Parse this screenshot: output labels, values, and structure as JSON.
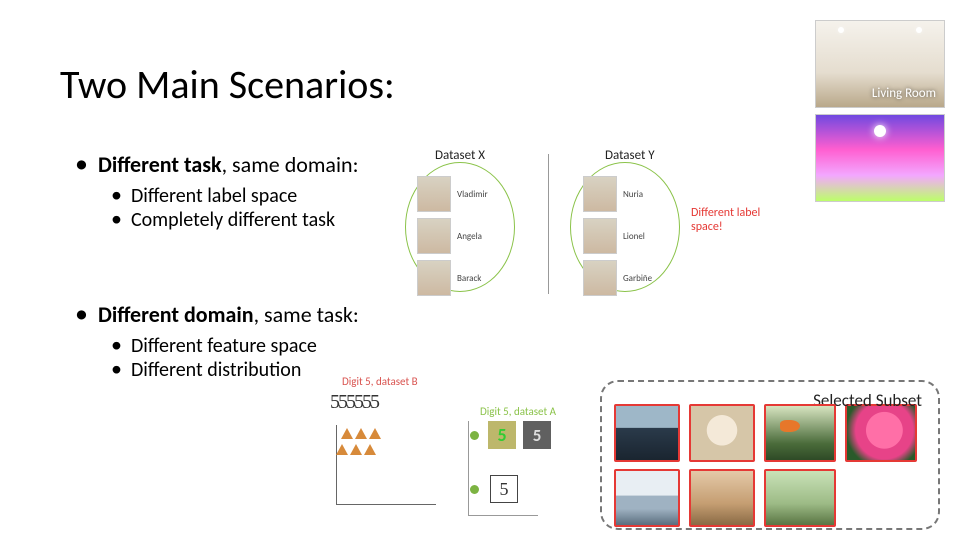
{
  "title": "Two Main Scenarios:",
  "scenario1": {
    "strong": "Different task",
    "rest": ", same domain:",
    "sub1": "Different label space",
    "sub2": "Completely different task"
  },
  "scenario2": {
    "strong": "Different domain",
    "rest": ", same task:",
    "sub1": "Different feature space",
    "sub2": "Different distribution"
  },
  "fig_faces": {
    "datasetX_label": "Dataset X",
    "datasetY_label": "Dataset Y",
    "x_names": [
      "Vladimir",
      "Angela",
      "Barack"
    ],
    "y_names": [
      "Nuria",
      "Lionel",
      "Garbiñe"
    ],
    "callout": "Different label space!"
  },
  "rooms": {
    "caption": "Living Room"
  },
  "fig_digits": {
    "label_b": "Digit 5, dataset B",
    "label_a": "Digit 5, dataset A",
    "handwritten": "555555",
    "glyph_a1": "5",
    "glyph_a2": "5",
    "glyph_a3": "5"
  },
  "subset": {
    "title": "Selected Subset"
  }
}
